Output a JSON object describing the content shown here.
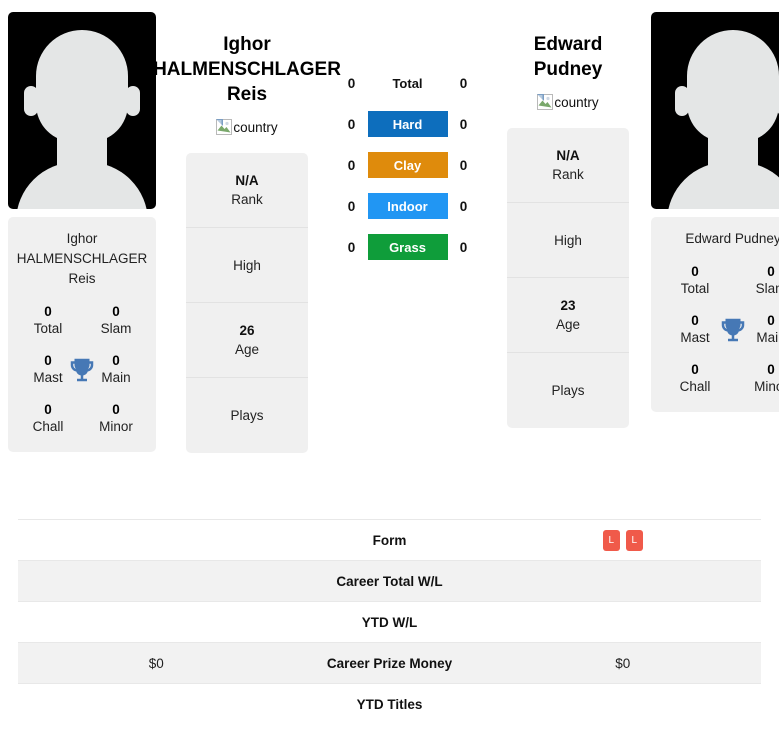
{
  "players": {
    "left": {
      "name_lines": [
        "Ighor",
        "HALMENSCHLAGER",
        "Reis"
      ],
      "flag_alt": "country",
      "avatar_name": "player-avatar-left",
      "card_name_lines": [
        "Ighor",
        "HALMENSCHLAGER",
        "Reis"
      ],
      "titles": [
        {
          "value": "0",
          "label": "Total"
        },
        {
          "value": "0",
          "label": "Slam"
        },
        {
          "value": "0",
          "label": "Mast"
        },
        {
          "value": "0",
          "label": "Main"
        },
        {
          "value": "0",
          "label": "Chall"
        },
        {
          "value": "0",
          "label": "Minor"
        }
      ],
      "info": [
        {
          "value": "N/A",
          "label": "Rank"
        },
        {
          "value": "",
          "label": "High"
        },
        {
          "value": "26",
          "label": "Age"
        },
        {
          "value": "",
          "label": "Plays"
        }
      ]
    },
    "right": {
      "name_lines": [
        "Edward",
        "Pudney"
      ],
      "flag_alt": "country",
      "avatar_name": "player-avatar-right",
      "card_name_lines": [
        "Edward Pudney"
      ],
      "titles": [
        {
          "value": "0",
          "label": "Total"
        },
        {
          "value": "0",
          "label": "Slam"
        },
        {
          "value": "0",
          "label": "Mast"
        },
        {
          "value": "0",
          "label": "Main"
        },
        {
          "value": "0",
          "label": "Chall"
        },
        {
          "value": "0",
          "label": "Minor"
        }
      ],
      "info": [
        {
          "value": "N/A",
          "label": "Rank"
        },
        {
          "value": "",
          "label": "High"
        },
        {
          "value": "23",
          "label": "Age"
        },
        {
          "value": "",
          "label": "Plays"
        }
      ]
    }
  },
  "h2h": {
    "rows": [
      {
        "left": "0",
        "label": "Total",
        "right": "0",
        "color": "",
        "plain": true
      },
      {
        "left": "0",
        "label": "Hard",
        "right": "0",
        "color": "#0d6ebd",
        "plain": false
      },
      {
        "left": "0",
        "label": "Clay",
        "right": "0",
        "color": "#df8b0c",
        "plain": false
      },
      {
        "left": "0",
        "label": "Indoor",
        "right": "0",
        "color": "#2196f3",
        "plain": false
      },
      {
        "left": "0",
        "label": "Grass",
        "right": "0",
        "color": "#0f9d3a",
        "plain": false
      }
    ]
  },
  "comparison_table": {
    "form_badge_color": "#f05a4a",
    "rows": [
      {
        "label": "Form",
        "left": "",
        "right": "",
        "left_badges": [],
        "right_badges": [
          "L",
          "L"
        ],
        "shaded": false
      },
      {
        "label": "Career Total W/L",
        "left": "",
        "right": "",
        "left_badges": [],
        "right_badges": [],
        "shaded": true
      },
      {
        "label": "YTD W/L",
        "left": "",
        "right": "",
        "left_badges": [],
        "right_badges": [],
        "shaded": false
      },
      {
        "label": "Career Prize Money",
        "left": "$0",
        "right": "$0",
        "left_badges": [],
        "right_badges": [],
        "shaded": true
      },
      {
        "label": "YTD Titles",
        "left": "",
        "right": "",
        "left_badges": [],
        "right_badges": [],
        "shaded": false
      }
    ]
  }
}
